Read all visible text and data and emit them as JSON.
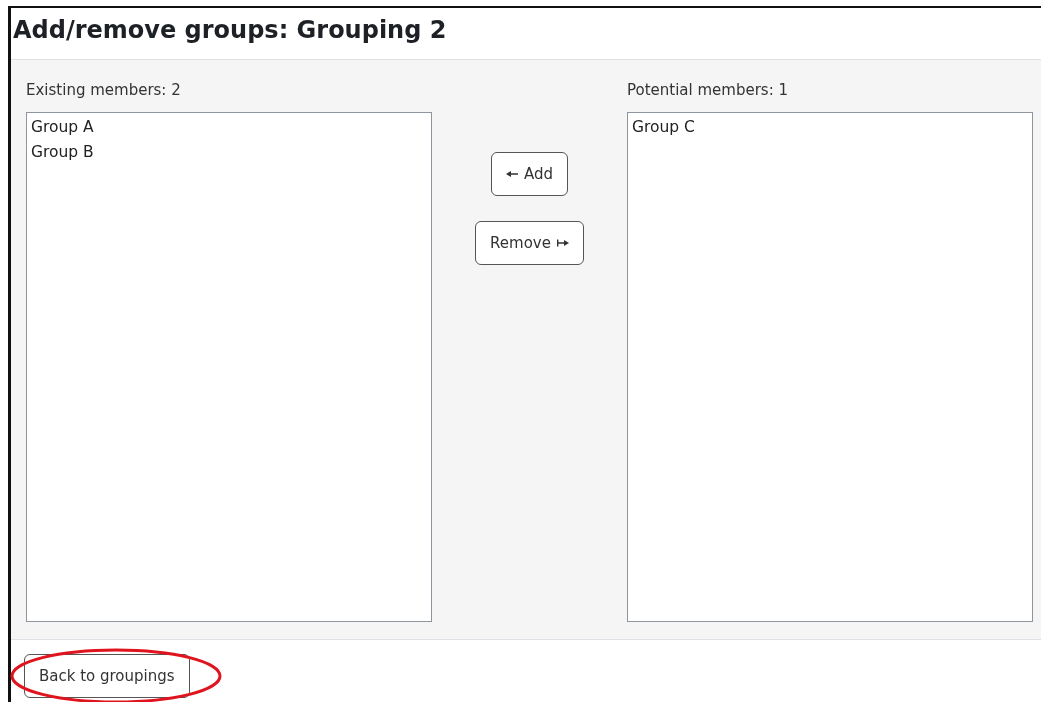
{
  "page": {
    "title": "Add/remove groups: Grouping 2"
  },
  "existing": {
    "label": "Existing members: 2",
    "items": [
      {
        "text": "Group A",
        "selected": false
      },
      {
        "text": "Group B",
        "selected": false
      }
    ]
  },
  "actions": [
    {
      "kind": "add",
      "label": "Add"
    },
    {
      "kind": "remove",
      "label": "Remove"
    }
  ],
  "potential": {
    "label": "Potential members: 1",
    "items": [
      {
        "text": "Group C",
        "selected": false
      }
    ]
  },
  "footer": {
    "button": "Back to groupings",
    "highlighted": true
  }
}
